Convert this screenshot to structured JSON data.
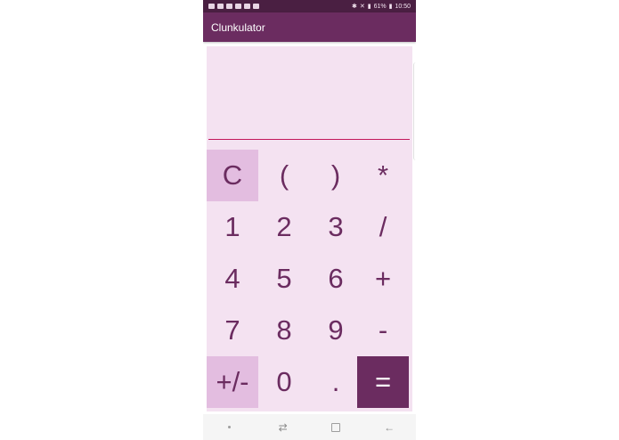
{
  "status_bar": {
    "battery": "61%",
    "time": "10:50"
  },
  "app_bar": {
    "title": "Clunkulator"
  },
  "display": {
    "value": ""
  },
  "keys": [
    {
      "label": "C",
      "name": "clear-button",
      "style": "pink"
    },
    {
      "label": "(",
      "name": "open-paren-button",
      "style": "plain"
    },
    {
      "label": ")",
      "name": "close-paren-button",
      "style": "plain"
    },
    {
      "label": "*",
      "name": "multiply-button",
      "style": "plain"
    },
    {
      "label": "1",
      "name": "digit-1-button",
      "style": "plain"
    },
    {
      "label": "2",
      "name": "digit-2-button",
      "style": "plain"
    },
    {
      "label": "3",
      "name": "digit-3-button",
      "style": "plain"
    },
    {
      "label": "/",
      "name": "divide-button",
      "style": "plain"
    },
    {
      "label": "4",
      "name": "digit-4-button",
      "style": "plain"
    },
    {
      "label": "5",
      "name": "digit-5-button",
      "style": "plain"
    },
    {
      "label": "6",
      "name": "digit-6-button",
      "style": "plain"
    },
    {
      "label": "+",
      "name": "add-button",
      "style": "plain"
    },
    {
      "label": "7",
      "name": "digit-7-button",
      "style": "plain"
    },
    {
      "label": "8",
      "name": "digit-8-button",
      "style": "plain"
    },
    {
      "label": "9",
      "name": "digit-9-button",
      "style": "plain"
    },
    {
      "label": "-",
      "name": "subtract-button",
      "style": "plain"
    },
    {
      "label": "+/-",
      "name": "toggle-sign-button",
      "style": "pink"
    },
    {
      "label": "0",
      "name": "digit-0-button",
      "style": "plain"
    },
    {
      "label": ".",
      "name": "decimal-button",
      "style": "plain"
    },
    {
      "label": "=",
      "name": "equals-button",
      "style": "dark"
    }
  ],
  "colors": {
    "app_bar": "#6b2c60",
    "status_bar": "#4a1f42",
    "keypad_background": "#f4e2f1",
    "accent_key": "#e3bde0",
    "display_underline": "#c2185b"
  },
  "nav_bar": {
    "icons": [
      "menu-dot-icon",
      "recent-apps-icon",
      "home-icon",
      "back-icon"
    ]
  }
}
